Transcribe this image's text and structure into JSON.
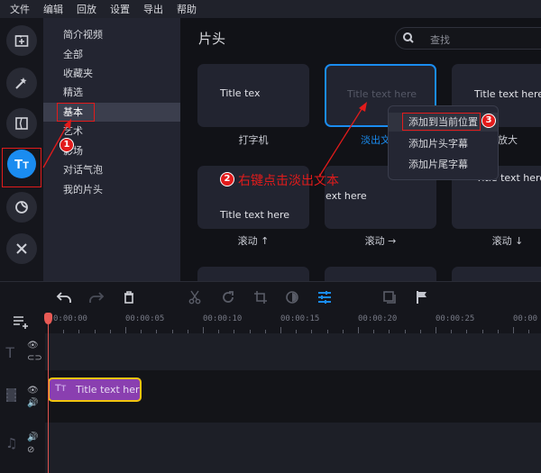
{
  "menu": [
    "文件",
    "编辑",
    "回放",
    "设置",
    "导出",
    "帮助"
  ],
  "leftbar": [
    {
      "icon": "import-icon"
    },
    {
      "icon": "magic-wand-icon"
    },
    {
      "icon": "transitions-icon"
    },
    {
      "icon": "titles-icon",
      "active": true
    },
    {
      "icon": "stickers-icon"
    },
    {
      "icon": "tools-icon"
    }
  ],
  "categories": [
    "简介视频",
    "全部",
    "收藏夹",
    "精选",
    "基本",
    "艺术",
    "影场",
    "对话气泡",
    "我的片头"
  ],
  "selected_category": "基本",
  "content": {
    "title": "片头",
    "search_placeholder": "查找",
    "cards": [
      {
        "preview": "Title tex",
        "label": "打字机"
      },
      {
        "preview": "Title text here",
        "label": "淡出文本",
        "selected": true
      },
      {
        "preview": "Title text here",
        "label": "放大"
      },
      {
        "preview": "Title text here",
        "label": "滚动 ↑"
      },
      {
        "preview": "ext here",
        "label": "滚动 →"
      },
      {
        "preview": "Title text here",
        "label": "滚动 ↓"
      }
    ]
  },
  "context_menu": [
    "添加到当前位置",
    "添加片头字幕",
    "添加片尾字幕"
  ],
  "annotations": {
    "step1": "1",
    "step2": "2",
    "step3": "3",
    "step2_text": "右键点击淡出文本"
  },
  "toolbar": [
    "undo-icon",
    "redo-icon",
    "delete-icon",
    "cut-icon",
    "rotate-icon",
    "crop-icon",
    "color-icon",
    "adjust-icon",
    "pip-icon",
    "flag-icon"
  ],
  "timeline": {
    "ticks": [
      "0:00:00",
      "00:00:05",
      "00:00:10",
      "00:00:15",
      "00:00:20",
      "00:00:25",
      "00:00"
    ],
    "clip_label": "Title text her"
  },
  "colors": {
    "accent": "#1a8cf0",
    "clip": "#8a3fb0",
    "clip_border": "#f1c40f",
    "annotation": "#e21b1b",
    "playhead": "#e0534f"
  }
}
